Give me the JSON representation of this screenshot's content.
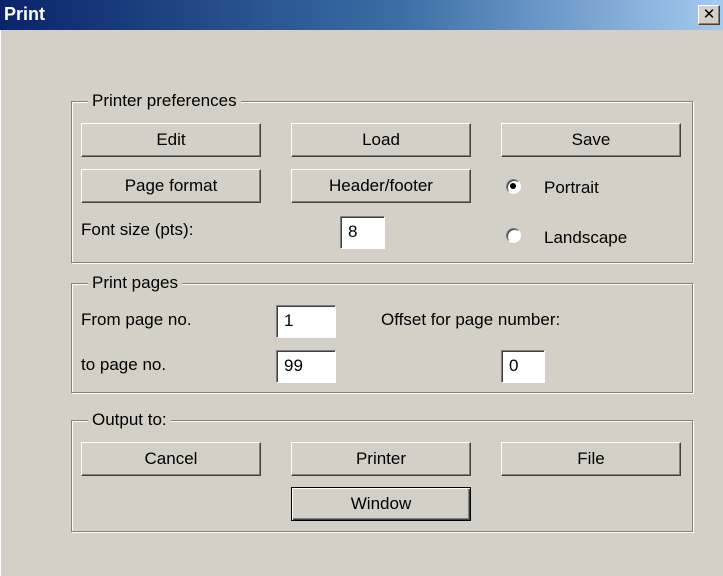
{
  "window": {
    "title": "Print",
    "close_glyph": "✕"
  },
  "printer_preferences": {
    "legend": "Printer preferences",
    "edit_label": "Edit",
    "load_label": "Load",
    "save_label": "Save",
    "page_format_label": "Page format",
    "header_footer_label": "Header/footer",
    "font_size_label": "Font size (pts):",
    "font_size_value": "8",
    "orientation": {
      "portrait_label": "Portrait",
      "landscape_label": "Landscape",
      "selected": "Portrait"
    }
  },
  "print_pages": {
    "legend": "Print pages",
    "from_label": "From page no.",
    "from_value": "1",
    "to_label": "to page no.",
    "to_value": "99",
    "offset_label": "Offset for page number:",
    "offset_value": "0"
  },
  "output_to": {
    "legend": "Output to:",
    "cancel_label": "Cancel",
    "printer_label": "Printer",
    "file_label": "File",
    "window_label": "Window"
  }
}
